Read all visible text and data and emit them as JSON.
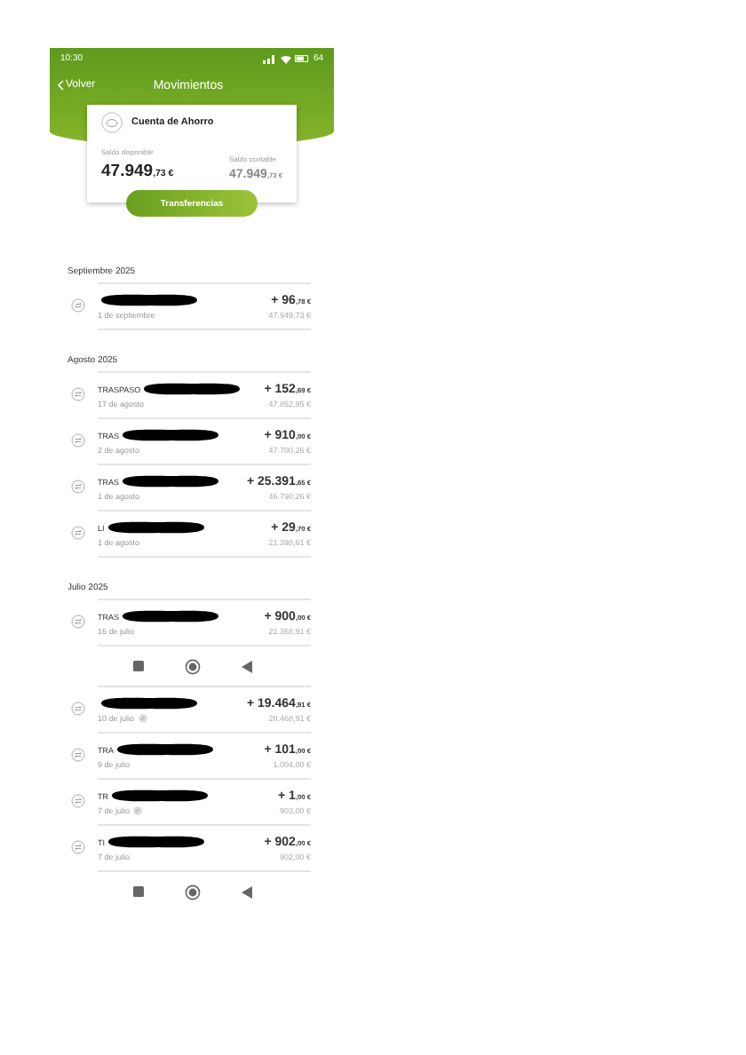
{
  "status_bar": {
    "time": "10:30",
    "battery": "64"
  },
  "header": {
    "back": "Volver",
    "title": "Movimientos"
  },
  "account": {
    "name": "Cuenta de Ahorro",
    "available_label": "Saldo disponible",
    "available_amount": "47.949",
    "available_cents": ",73 €",
    "book_label": "Saldo contable",
    "book_amount": "47.949",
    "book_cents": ",73 €"
  },
  "action_button": "Transferencias",
  "screens": [
    {
      "sections": [
        {
          "title": "Septiembre 2025",
          "items": [
            {
              "date": "1 de septiembre",
              "amount": "+ 96",
              "cents": ",78 €",
              "balance": "47.949,73 €",
              "attachment": false
            }
          ]
        },
        {
          "title": "Agosto 2025",
          "items": [
            {
              "name": "TRASPASO",
              "date": "17 de agosto",
              "amount": "+ 152",
              "cents": ",69 €",
              "balance": "47.852,95 €",
              "attachment": false
            },
            {
              "name": "TRAS",
              "date": "2 de agosto",
              "amount": "+ 910",
              "cents": ",00 €",
              "balance": "47.700,26 €",
              "attachment": false
            },
            {
              "name": "TRAS",
              "date": "1 de agosto",
              "amount": "+ 25.391",
              "cents": ",65 €",
              "balance": "46.790,26 €",
              "attachment": false
            },
            {
              "name": "LI",
              "date": "1 de agosto",
              "amount": "+ 29",
              "cents": ",70 €",
              "balance": "21.398,61 €",
              "attachment": false
            }
          ]
        },
        {
          "title": "Julio 2025",
          "items": [
            {
              "name": "TRAS",
              "date": "16 de julio",
              "amount": "+ 900",
              "cents": ",00 €",
              "balance": "21.368,91 €",
              "attachment": false
            }
          ]
        }
      ]
    },
    {
      "sections": [
        {
          "items": [
            {
              "date": "10 de julio",
              "amount": "+ 19.464",
              "cents": ",91 €",
              "balance": "20.468,91 €",
              "attachment": true
            },
            {
              "name": "TRA",
              "date": "9 de julio",
              "amount": "+ 101",
              "cents": ",00 €",
              "balance": "1.004,00 €",
              "attachment": false
            },
            {
              "name": "TR",
              "date": "7 de julio",
              "amount": "+ 1",
              "cents": ",00 €",
              "balance": "903,00 €",
              "attachment": true
            },
            {
              "name": "TI",
              "date": "7 de julio",
              "amount": "+ 902",
              "cents": ",00 €",
              "balance": "902,00 €",
              "attachment": false
            }
          ]
        }
      ]
    }
  ]
}
